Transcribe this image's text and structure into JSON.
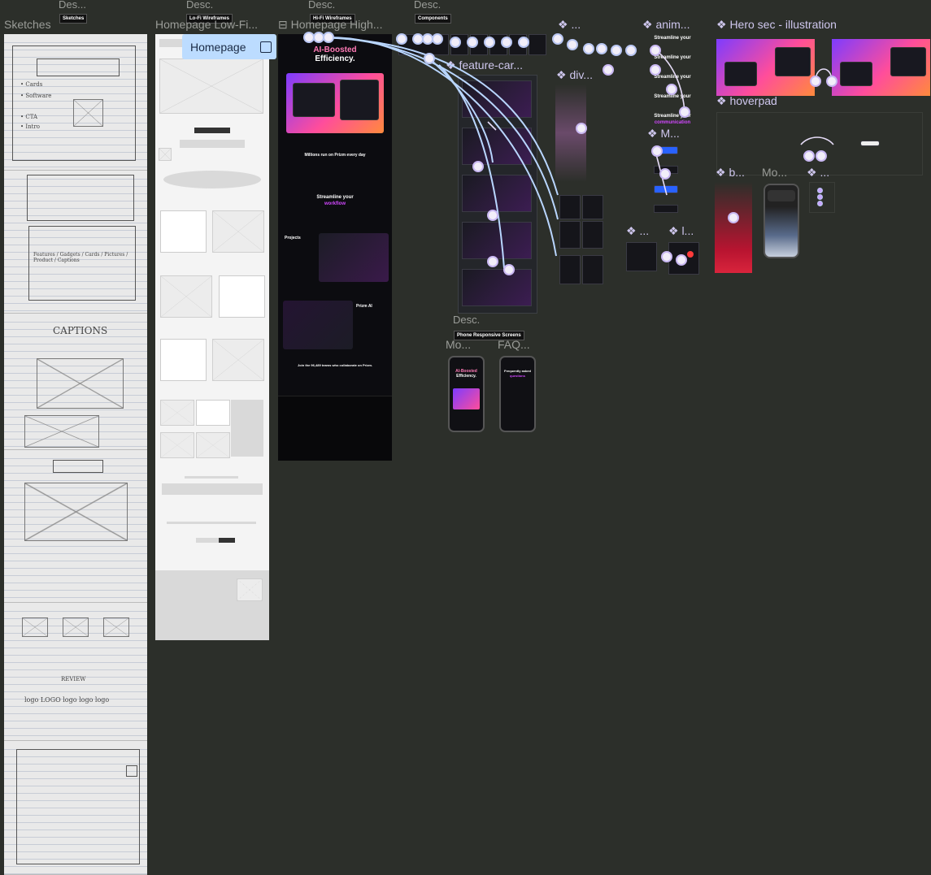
{
  "top_labels": {
    "sketches_desc": "Des...",
    "lofi_desc": "Desc.",
    "hifi_desc": "Desc.",
    "components_desc": "Desc."
  },
  "tags": {
    "sketches": "Sketches",
    "lofi": "Lo-Fi Wireframes",
    "hifi": "Hi-Fi Wireframes",
    "components": "Components",
    "phone": "Phone Responsive Screens"
  },
  "frames": {
    "sketches": "Sketches",
    "lofi": "Homepage Low-Fi...",
    "hifi": "Homepage High..."
  },
  "selection": {
    "label": "Homepage"
  },
  "components": {
    "feature_cards": "❖ feature-car...",
    "divider": "❖ div...",
    "anim": "❖ anim...",
    "hero_illustration": "❖ Hero sec - illustration",
    "hoverpad": "❖ hoverpad",
    "m": "❖ M...",
    "b": "❖ b...",
    "mo": "Mo...",
    "dots": "❖ ...",
    "small1": "❖ ...",
    "small2": "❖ l...",
    "top_small": "❖ ..."
  },
  "phones": {
    "desc": "Desc.",
    "mo": "Mo...",
    "faq": "FAQ..."
  },
  "hifi_content": {
    "hero_line1": "AI-Boosted",
    "hero_line2": "Efficiency.",
    "millions": "Millions run on Prizm every day",
    "streamline1": "Streamline your",
    "streamline2": "workflow",
    "projects": "Projects",
    "prizm_ai": "Prizm AI",
    "join": "Join the 96,489 teams who collaborate on Prizm."
  },
  "anim_lines": [
    "Streamline your",
    "Streamline your",
    "Streamline your",
    "Streamline your",
    "Streamline your"
  ],
  "anim_last": "communication",
  "phone_content": {
    "p1_line1": "AI-Boosted",
    "p1_line2": "Efficiency.",
    "p2_line1": "Frequently asked",
    "p2_line2": "questions"
  },
  "sketch_words": {
    "features": "Features / Gadgets / Cards / Pictures / Product / Captions",
    "captions": "CAPTIONS",
    "review": "REVIEW",
    "logos": "logo LOGO logo logo logo"
  }
}
